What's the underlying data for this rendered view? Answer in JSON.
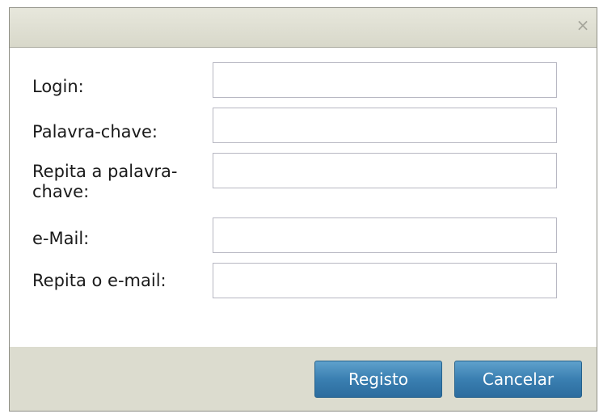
{
  "dialog": {
    "close_glyph": "×",
    "icon_names": {
      "close": "close-icon"
    }
  },
  "form": {
    "fields": [
      {
        "label": "Login:",
        "value": ""
      },
      {
        "label": "Palavra-chave:",
        "value": ""
      },
      {
        "label": "Repita a palavra-chave:",
        "value": ""
      },
      {
        "label": "e-Mail:",
        "value": ""
      },
      {
        "label": "Repita o e-mail:",
        "value": ""
      }
    ]
  },
  "buttons": {
    "register_label": "Registo",
    "cancel_label": "Cancelar"
  },
  "colors": {
    "button_blue": "#3a7fb1",
    "frame": "#dcdccf"
  }
}
